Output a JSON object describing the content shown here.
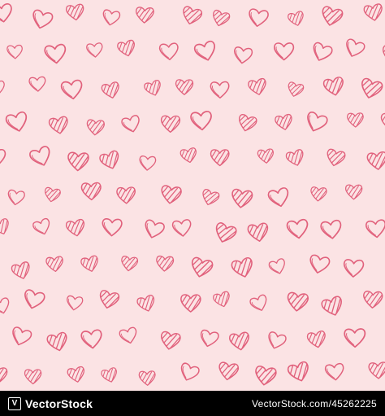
{
  "pattern": {
    "background_color": "#fbe3e4",
    "stroke_color": "#e1617c",
    "motif": "heart-icon"
  },
  "footer": {
    "background_color": "#000000",
    "brand_name": "VectorStock",
    "brand_mark": "V",
    "image_id": "VectorStock.com/45262225"
  }
}
